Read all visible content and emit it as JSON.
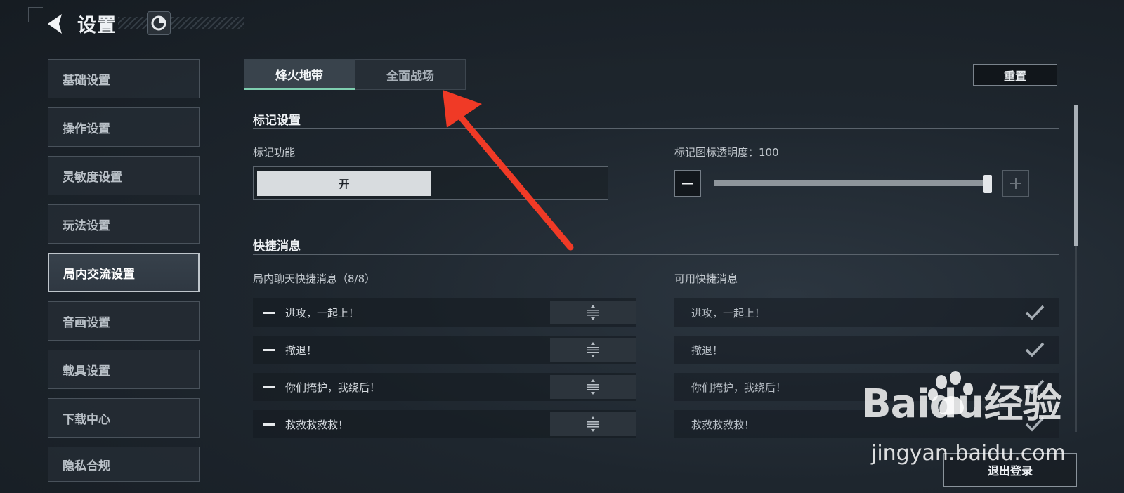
{
  "header": {
    "title": "设置",
    "back_icon": "back-arrow-icon",
    "profile_icon": "profile-badge-icon"
  },
  "sidebar": {
    "items": [
      {
        "label": "基础设置",
        "active": false
      },
      {
        "label": "操作设置",
        "active": false
      },
      {
        "label": "灵敏度设置",
        "active": false
      },
      {
        "label": "玩法设置",
        "active": false
      },
      {
        "label": "局内交流设置",
        "active": true
      },
      {
        "label": "音画设置",
        "active": false
      },
      {
        "label": "载具设置",
        "active": false
      },
      {
        "label": "下载中心",
        "active": false
      },
      {
        "label": "隐私合规",
        "active": false
      }
    ]
  },
  "tabs": [
    {
      "label": "烽火地带",
      "active": true
    },
    {
      "label": "全面战场",
      "active": false
    }
  ],
  "reset_label": "重置",
  "marker_section": {
    "title": "标记设置",
    "function_label": "标记功能",
    "toggle_on_label": "开",
    "opacity_label": "标记图标透明度：100",
    "opacity_value": 100,
    "opacity_fraction": 1.0
  },
  "quick_section": {
    "title": "快捷消息",
    "chat_label": "局内聊天快捷消息（8/8）",
    "available_label": "可用快捷消息",
    "chat_messages": [
      "进攻，一起上！",
      "撤退！",
      "你们掩护，我绕后！",
      "救救救救救！"
    ],
    "available_messages": [
      "进攻，一起上！",
      "撤退！",
      "你们掩护，我绕后！",
      "救救救救救！"
    ]
  },
  "logout_label": "退出登录",
  "watermark": {
    "logo_text": "Baidu经验",
    "url": "jingyan.baidu.com"
  },
  "colors": {
    "background": "#1e262e",
    "active_tab_underline": "#7fcfb0",
    "annotation_arrow": "#f03a26"
  }
}
